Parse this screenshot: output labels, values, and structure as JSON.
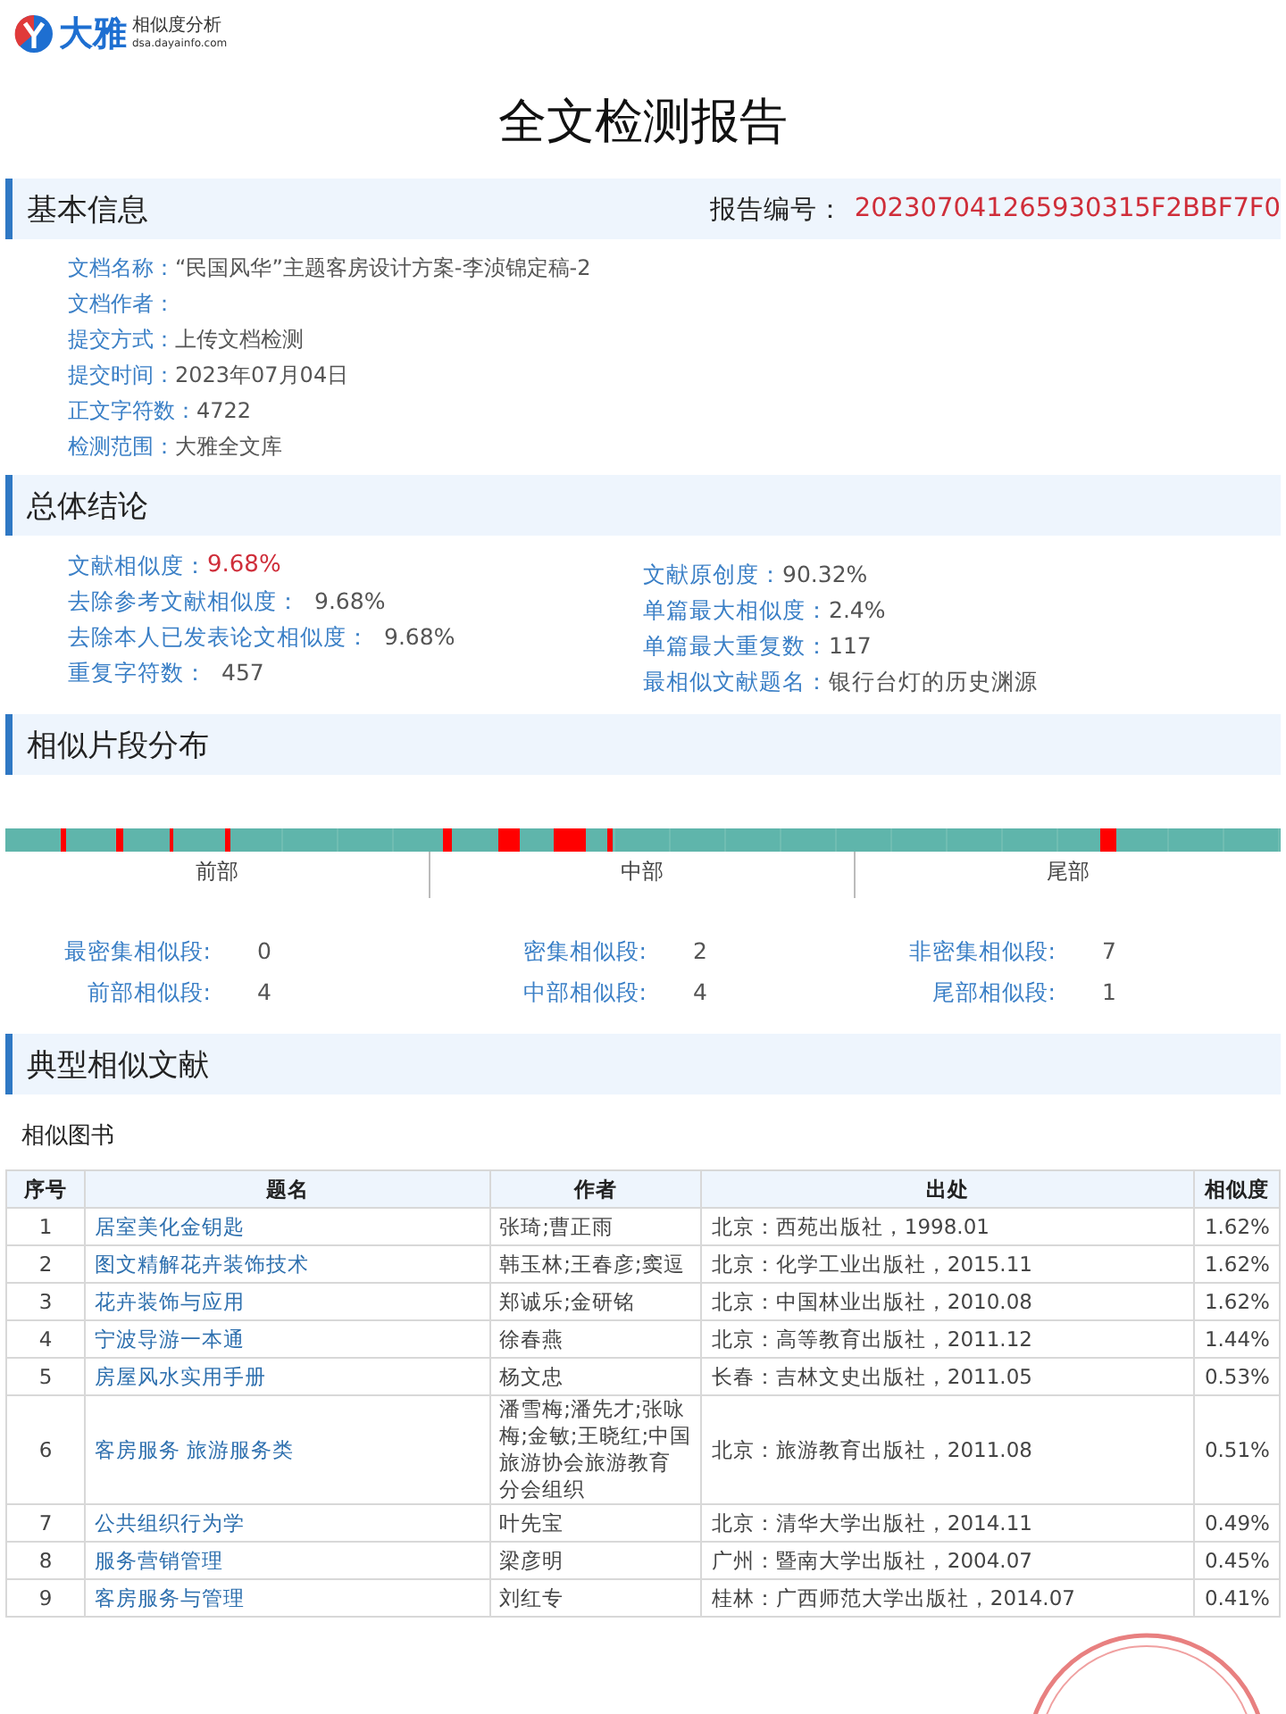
{
  "logo": {
    "brand": "大雅",
    "product": "相似度分析",
    "url": "dsa.dayainfo.com"
  },
  "title": "全文检测报告",
  "basic_info": {
    "heading": "基本信息",
    "report_no_label": "报告编号：",
    "report_no": "202307041265930315F2BBF7F0",
    "fields": [
      {
        "label": "文档名称：",
        "value": "“民国风华”主题客房设计方案-李浈锦定稿-2"
      },
      {
        "label": "文档作者："
      },
      {
        "label": "提交方式：",
        "value": "上传文档检测"
      },
      {
        "label": "提交时间：",
        "value": "2023年07月04日"
      },
      {
        "label": "正文字符数：",
        "value": "4722"
      },
      {
        "label": "检测范围：",
        "value": "大雅全文库"
      }
    ]
  },
  "conclusion": {
    "heading": "总体结论",
    "left": [
      {
        "label": "文献相似度：",
        "value": "9.68%",
        "highlight": true
      },
      {
        "label": "去除参考文献相似度：",
        "value": "9.68%",
        "highlight": false
      },
      {
        "label": "去除本人已发表论文相似度：",
        "value": "9.68%",
        "highlight": false
      },
      {
        "label": "重复字符数：",
        "value": "457",
        "highlight": false
      }
    ],
    "right": [
      {
        "label": "文献原创度：",
        "value": "90.32%",
        "highlight": false
      },
      {
        "label": "单篇最大相似度：",
        "value": "2.4%",
        "highlight": false
      },
      {
        "label": "单篇最大重复数：",
        "value": "117",
        "highlight": false
      },
      {
        "label": "最相似文献题名：",
        "value": "银行台灯的历史渊源",
        "highlight": false
      }
    ]
  },
  "distribution": {
    "heading": "相似片段分布",
    "parts": [
      "前部",
      "中部",
      "尾部"
    ],
    "stats": [
      {
        "label": "最密集相似段:",
        "value": "0"
      },
      {
        "label": "密集相似段:",
        "value": "2"
      },
      {
        "label": "非密集相似段:",
        "value": "7"
      },
      {
        "label": "前部相似段:",
        "value": "4"
      },
      {
        "label": "中部相似段:",
        "value": "4"
      },
      {
        "label": "尾部相似段:",
        "value": "1"
      }
    ]
  },
  "literature": {
    "heading": "典型相似文献",
    "subheading": "相似图书",
    "columns": [
      "序号",
      "题名",
      "作者",
      "出处",
      "相似度"
    ],
    "rows": [
      [
        "1",
        "居室美化金钥匙",
        "张琦;曹正雨",
        "北京：西苑出版社，1998.01",
        "1.62%"
      ],
      [
        "2",
        "图文精解花卉装饰技术",
        "韩玉林;王春彦;窦逗",
        "北京：化学工业出版社，2015.11",
        "1.62%"
      ],
      [
        "3",
        "花卉装饰与应用",
        "郑诚乐;金研铭",
        "北京：中国林业出版社，2010.08",
        "1.62%"
      ],
      [
        "4",
        "宁波导游一本通",
        "徐春燕",
        "北京：高等教育出版社，2011.12",
        "1.44%"
      ],
      [
        "5",
        "房屋风水实用手册",
        "杨文忠",
        "长春：吉林文史出版社，2011.05",
        "0.53%"
      ],
      [
        "6",
        "客房服务 旅游服务类",
        "潘雪梅;潘先才;张咏梅;金敏;王晓红;中国旅游协会旅游教育分会组织",
        "北京：旅游教育出版社，2011.08",
        "0.51%"
      ],
      [
        "7",
        "公共组织行为学",
        "叶先宝",
        "北京：清华大学出版社，2014.11",
        "0.49%"
      ],
      [
        "8",
        "服务营销管理",
        "梁彦明",
        "广州：暨南大学出版社，2004.07",
        "0.45%"
      ],
      [
        "9",
        "客房服务与管理",
        "刘红专",
        "桂林：广西师范大学出版社，2014.07",
        "0.41%"
      ]
    ]
  }
}
